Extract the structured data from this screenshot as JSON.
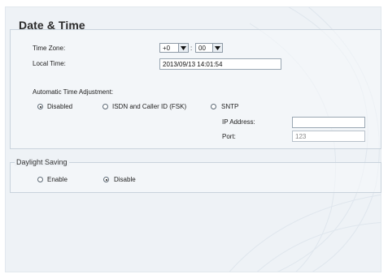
{
  "page_title": "Date & Time",
  "time_zone": {
    "label": "Time Zone:",
    "hour_value": "+0",
    "separator": ":",
    "minute_value": "00"
  },
  "local_time": {
    "label": "Local Time:",
    "value": "2013/09/13 14:01:54"
  },
  "auto_adjust": {
    "label": "Automatic Time Adjustment:",
    "options": [
      {
        "label": "Disabled",
        "selected": true
      },
      {
        "label": "ISDN and Caller ID (FSK)",
        "selected": false
      },
      {
        "label": "SNTP",
        "selected": false
      }
    ]
  },
  "sntp": {
    "ip_label": "IP Address:",
    "ip_value": "",
    "port_label": "Port:",
    "port_value": "123"
  },
  "daylight_saving": {
    "legend": "Daylight Saving",
    "options": [
      {
        "label": "Enable",
        "selected": false
      },
      {
        "label": "Disable",
        "selected": true
      }
    ]
  }
}
